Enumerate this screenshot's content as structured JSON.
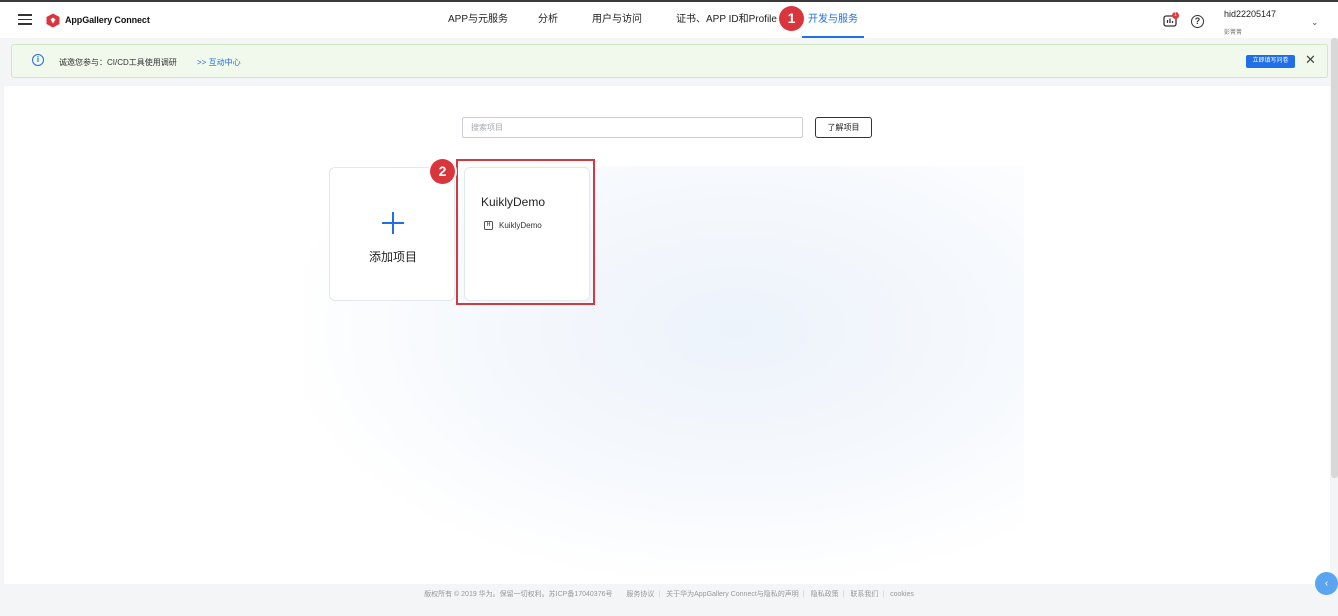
{
  "header": {
    "brand": "AppGallery Connect",
    "nav": [
      {
        "label": "APP与元服务"
      },
      {
        "label": "分析"
      },
      {
        "label": "用户与访问"
      },
      {
        "label": "证书、APP ID和Profile"
      },
      {
        "label": "开发与服务"
      }
    ],
    "step_badges": [
      "1",
      "2"
    ],
    "notification_count": "1",
    "help_glyph": "?",
    "user": {
      "id": "hid22205147",
      "subtitle": "彭菁菁"
    }
  },
  "banner": {
    "text": "诚邀您参与：CI/CD工具使用调研",
    "link": ">> 互动中心",
    "button": "立即填写问卷"
  },
  "main": {
    "search_placeholder": "搜索项目",
    "learn_button": "了解项目",
    "add_project_label": "添加项目",
    "project": {
      "title": "KuiklyDemo",
      "app_icon_glyph": "H",
      "app_name": "KuiklyDemo"
    }
  },
  "footer": {
    "copyright": "版权所有 © 2019 华为。保留一切权利。苏ICP备17040376号",
    "links": [
      "服务协议",
      "关于华为AppGallery Connect与隐私的声明",
      "隐私政策",
      "联系我们",
      "cookies"
    ]
  },
  "colors": {
    "accent": "#1e6fe8",
    "badge": "#d8353d",
    "banner_bg": "#f1f8ec"
  },
  "icons": [
    "menu-icon",
    "huawei-logo-icon",
    "notification-icon",
    "help-icon",
    "info-icon",
    "close-icon",
    "plus-icon",
    "harmony-app-icon",
    "chevron-down-icon",
    "collapse-left-icon"
  ]
}
